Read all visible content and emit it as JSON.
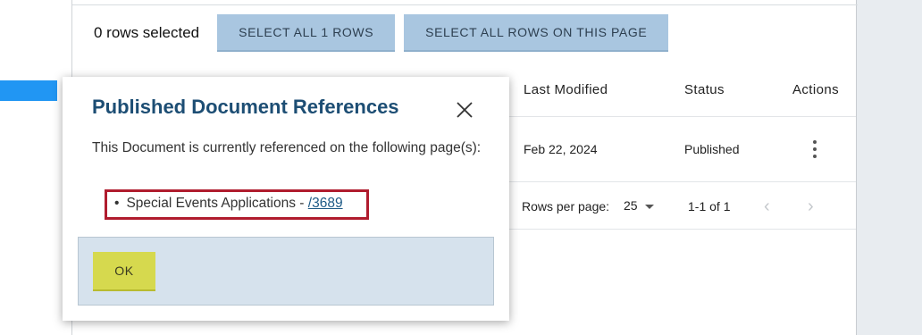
{
  "selection": {
    "count_text": "0 rows selected",
    "select_all_label": "SELECT ALL 1 ROWS",
    "select_page_label": "SELECT ALL ROWS ON THIS PAGE"
  },
  "table": {
    "columns": [
      "Last Modified",
      "Status",
      "Actions"
    ],
    "rows": [
      {
        "last_modified": "Feb 22, 2024",
        "status": "Published"
      }
    ]
  },
  "pagination": {
    "rows_per_page_label": "Rows per page:",
    "rows_per_page_value": "25",
    "range_text": "1-1 of 1",
    "prev_icon": "‹",
    "next_icon": "›"
  },
  "dialog": {
    "title": "Published Document References",
    "body": "This Document is currently referenced on the following page(s):",
    "reference": {
      "bullet": "•",
      "text": "Special Events Applications - ",
      "link": "/3689"
    },
    "ok_label": "OK"
  },
  "colors": {
    "title": "#1d4e74",
    "highlight_border": "#b01c2e",
    "select_button": "#a9c6e0",
    "ok_button": "#d6d94e",
    "footer": "#d6e2ed"
  }
}
